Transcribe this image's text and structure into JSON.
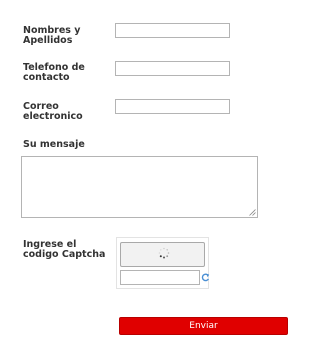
{
  "form": {
    "name_label": "Nombres y Apellidos",
    "name_value": "",
    "phone_label": "Telefono de contacto",
    "phone_value": "",
    "email_label": "Correo electronico",
    "email_value": "",
    "message_label": "Su mensaje",
    "message_value": "",
    "captcha_label": "Ingrese el codigo Captcha",
    "captcha_value": "",
    "submit_label": "Enviar"
  },
  "icons": {
    "captcha_loading": "loading-spinner-icon",
    "captcha_refresh": "refresh-icon",
    "textarea_resize": "resize-handle-icon"
  },
  "colors": {
    "submit_background": "#e00000",
    "submit_text": "#ffffff",
    "label_text": "#333333",
    "field_border": "#b4b4b4"
  }
}
